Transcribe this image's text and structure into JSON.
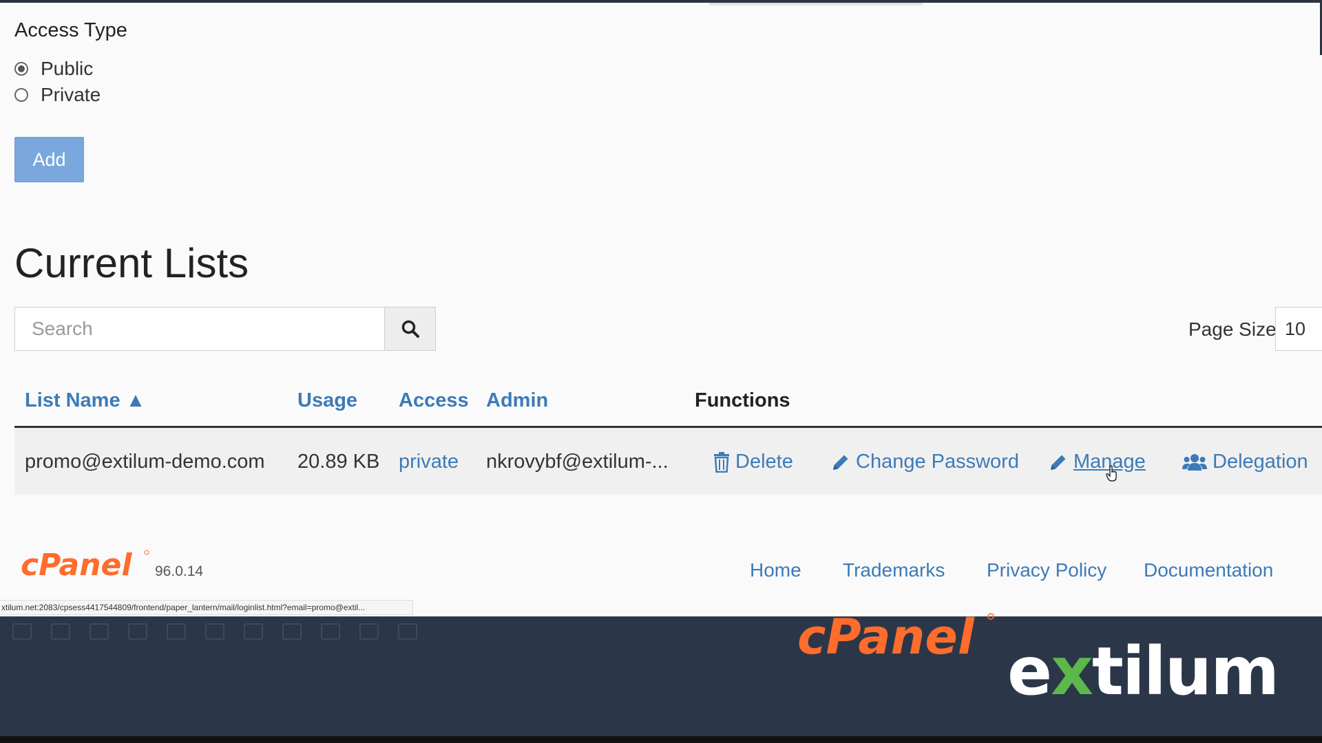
{
  "form": {
    "access_type_label": "Access Type",
    "options": [
      {
        "label": "Public",
        "checked": true
      },
      {
        "label": "Private",
        "checked": false
      }
    ],
    "add_button": "Add"
  },
  "lists": {
    "title": "Current Lists",
    "search_placeholder": "Search",
    "page_size_label": "Page Size",
    "page_size_value": "10",
    "columns": {
      "list_name": "List Name ▲",
      "usage": "Usage",
      "access": "Access",
      "admin": "Admin",
      "functions": "Functions"
    },
    "rows": [
      {
        "list_name": "promo@extilum-demo.com",
        "usage": "20.89 KB",
        "access": "private",
        "admin": "nkrovybf@extilum-..."
      }
    ],
    "actions": {
      "delete": "Delete",
      "change_password": "Change Password",
      "manage": "Manage",
      "delegation": "Delegation"
    }
  },
  "footer": {
    "logo_text": "cPanel",
    "version": "96.0.14",
    "links": [
      "Home",
      "Trademarks",
      "Privacy Policy",
      "Documentation"
    ]
  },
  "status_url": "xtilum.net:2083/cpsess4417544809/frontend/paper_lantern/mail/loginlist.html?email=promo@extil...",
  "branding": {
    "cpanel": "cPanel",
    "extilum_prefix": "e",
    "extilum_x": "x",
    "extilum_suffix": "tilum"
  },
  "colors": {
    "link": "#3d7ab8",
    "add_button": "#7aa8dd",
    "cpanel_orange": "#ff6c2c",
    "bottom_bar": "#2b3749",
    "extilum_x_green": "#5cb84a"
  }
}
